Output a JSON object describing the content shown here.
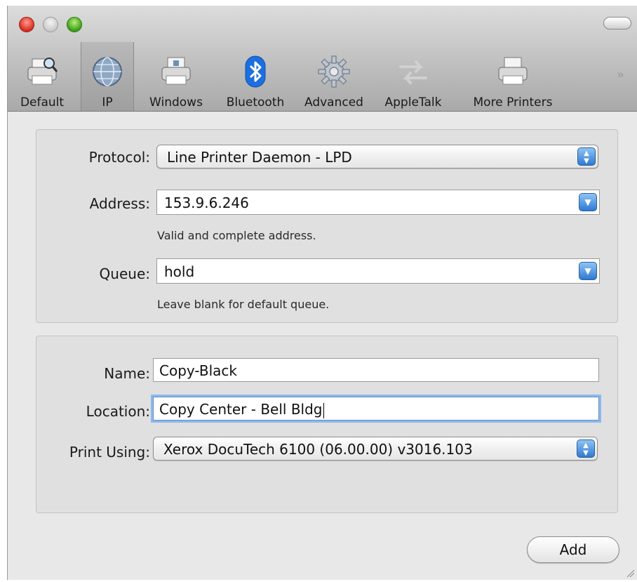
{
  "toolbar": {
    "items": [
      {
        "label": "Default",
        "icon": "printer-magnifier-icon"
      },
      {
        "label": "IP",
        "icon": "globe-icon",
        "selected": true
      },
      {
        "label": "Windows",
        "icon": "printer-windows-icon"
      },
      {
        "label": "Bluetooth",
        "icon": "bluetooth-icon"
      },
      {
        "label": "Advanced",
        "icon": "gear-icon"
      },
      {
        "label": "AppleTalk",
        "icon": "arrows-icon"
      },
      {
        "label": "More Printers",
        "icon": "printer-icon"
      }
    ],
    "overflow": "»"
  },
  "connection": {
    "protocol_label": "Protocol:",
    "protocol_value": "Line Printer Daemon - LPD",
    "address_label": "Address:",
    "address_value": "153.9.6.246",
    "address_help": "Valid and complete address.",
    "queue_label": "Queue:",
    "queue_value": "hold",
    "queue_help": "Leave blank for default queue."
  },
  "printer": {
    "name_label": "Name:",
    "name_value": "Copy-Black",
    "location_label": "Location:",
    "location_value": "Copy Center - Bell Bldg",
    "print_using_label": "Print Using:",
    "print_using_value": "Xerox DocuTech 6100 (06.00.00) v3016.103"
  },
  "actions": {
    "add_label": "Add"
  },
  "colors": {
    "accent": "#2f79d2",
    "focus_ring": "#8fb8ea"
  }
}
